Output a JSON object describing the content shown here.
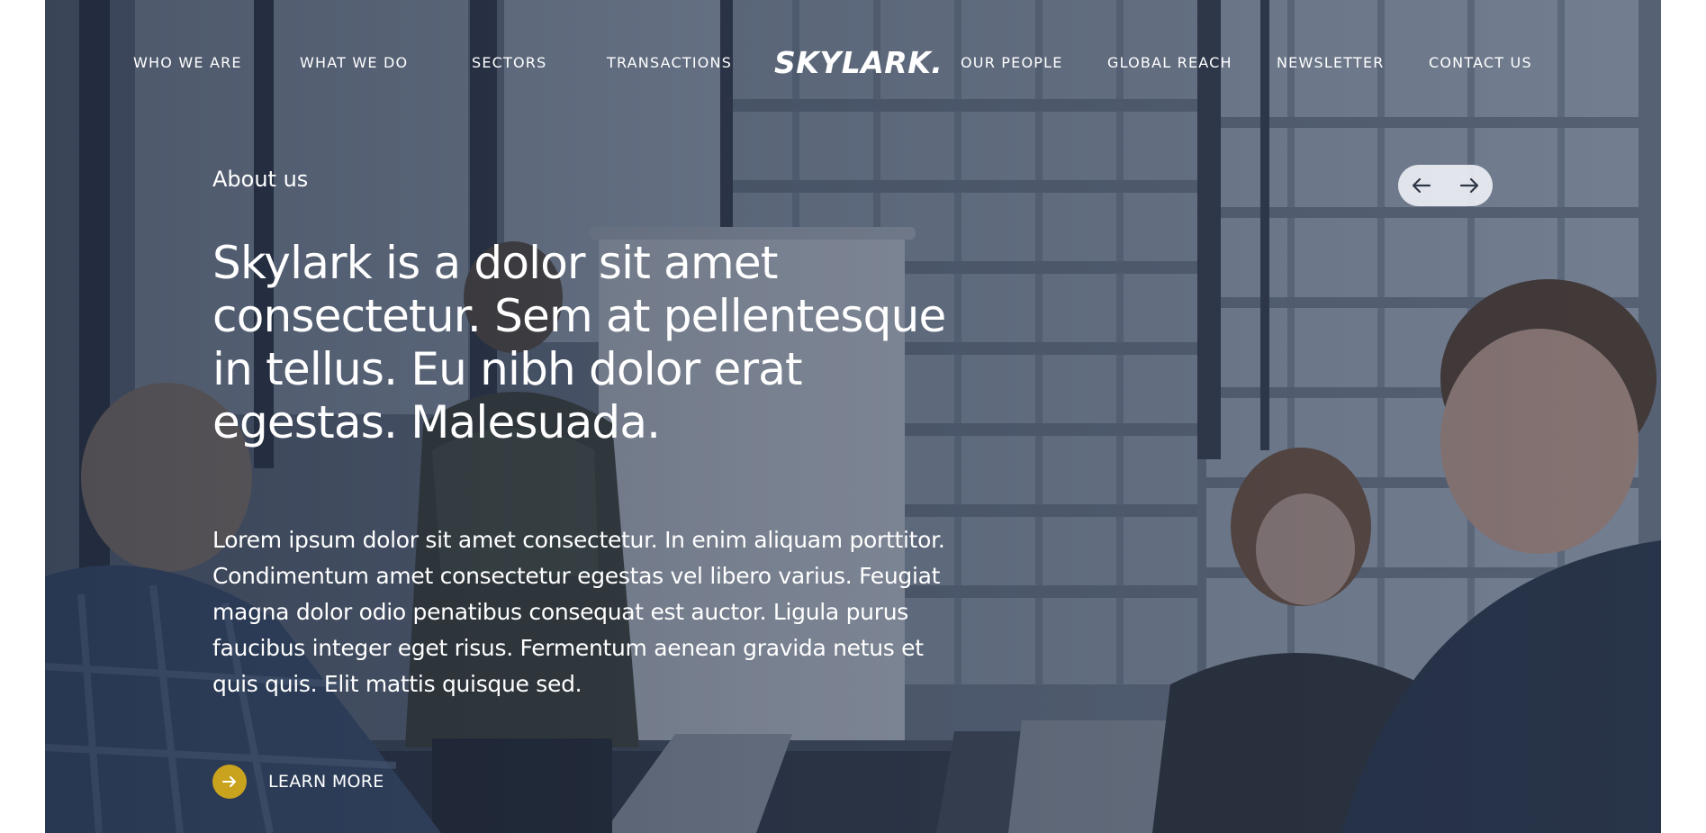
{
  "nav": {
    "left_items": [
      {
        "label": "WHO WE ARE"
      },
      {
        "label": "WHAT WE DO"
      },
      {
        "label": "SECTORS"
      },
      {
        "label": "TRANSACTIONS"
      }
    ],
    "logo": "SKYLARK.",
    "right_items": [
      {
        "label": "OUR PEOPLE"
      },
      {
        "label": "GLOBAL REACH"
      },
      {
        "label": "NEWSLETTER"
      },
      {
        "label": "CONTACT US"
      }
    ]
  },
  "hero": {
    "eyebrow": "About us",
    "headline": "Skylark is a dolor sit amet consectetur. Sem at pellentesque in tellus. Eu nibh dolor erat egestas. Malesuada.",
    "body": "Lorem ipsum dolor sit amet consectetur. In enim aliquam porttitor. Condimentum amet consectetur egestas vel libero varius. Feugiat magna dolor odio penatibus consequat est auctor. Ligula purus faucibus integer eget risus. Fermentum aenean gravida netus et quis quis. Elit mattis quisque sed.",
    "cta_label": "LEARN MORE",
    "cta_icon": "arrow-right-icon",
    "slider_prev_icon": "arrow-left-icon",
    "slider_next_icon": "arrow-right-icon"
  },
  "colors": {
    "accent": "#c9a21e",
    "overlay": "#2a3650",
    "text": "#ffffff",
    "slider_bg": "#ebeef4"
  }
}
